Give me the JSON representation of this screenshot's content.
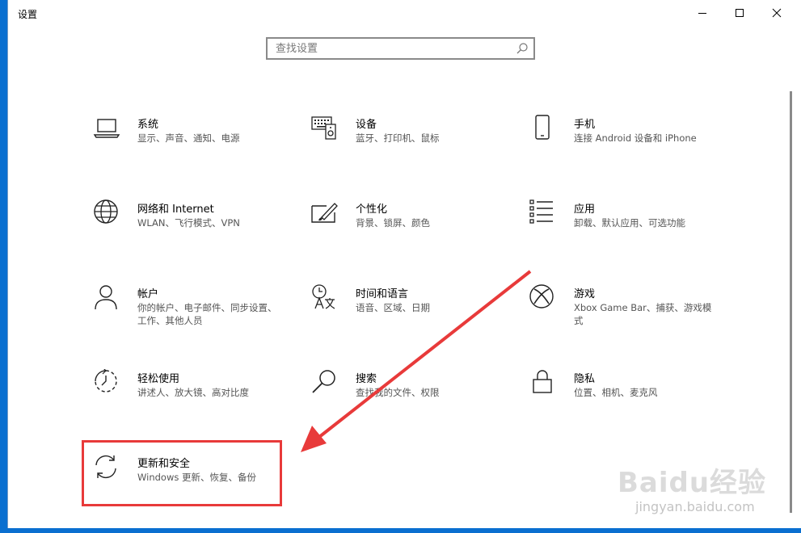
{
  "window": {
    "title": "设置"
  },
  "search": {
    "placeholder": "查找设置"
  },
  "tiles": [
    {
      "name": "系统",
      "desc": "显示、声音、通知、电源",
      "icon": "laptop-icon"
    },
    {
      "name": "设备",
      "desc": "蓝牙、打印机、鼠标",
      "icon": "keyboard-icon"
    },
    {
      "name": "手机",
      "desc": "连接 Android 设备和 iPhone",
      "icon": "phone-icon"
    },
    {
      "name": "网络和 Internet",
      "desc": "WLAN、飞行模式、VPN",
      "icon": "globe-icon"
    },
    {
      "name": "个性化",
      "desc": "背景、锁屏、颜色",
      "icon": "paint-icon"
    },
    {
      "name": "应用",
      "desc": "卸载、默认应用、可选功能",
      "icon": "apps-list-icon"
    },
    {
      "name": "帐户",
      "desc": "你的帐户、电子邮件、同步设置、工作、其他人员",
      "icon": "person-icon"
    },
    {
      "name": "时间和语言",
      "desc": "语音、区域、日期",
      "icon": "time-language-icon"
    },
    {
      "name": "游戏",
      "desc": "Xbox Game Bar、捕获、游戏模式",
      "icon": "xbox-icon"
    },
    {
      "name": "轻松使用",
      "desc": "讲述人、放大镜、高对比度",
      "icon": "ease-of-access-icon"
    },
    {
      "name": "搜索",
      "desc": "查找我的文件、权限",
      "icon": "search-magnifier-icon"
    },
    {
      "name": "隐私",
      "desc": "位置、相机、麦克风",
      "icon": "lock-icon"
    },
    {
      "name": "更新和安全",
      "desc": "Windows 更新、恢复、备份",
      "icon": "update-icon"
    }
  ],
  "colors": {
    "annotation": "#e83a3a",
    "desktop": "#0a6fd0"
  },
  "watermark": {
    "brand": "Baidu经验",
    "url": "jingyan.baidu.com"
  }
}
